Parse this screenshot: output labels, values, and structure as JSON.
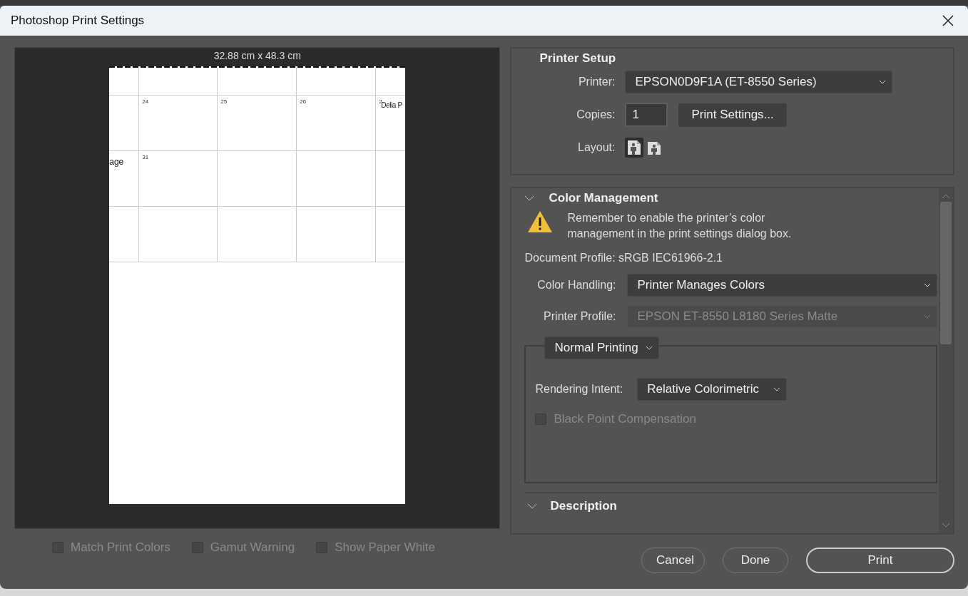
{
  "window": {
    "title": "Photoshop Print Settings"
  },
  "preview": {
    "size_label": "32.88 cm x 48.3 cm",
    "calendar_rows": [
      [
        {},
        {},
        {},
        {},
        {}
      ],
      [
        {},
        {
          "date": "24"
        },
        {
          "date": "25"
        },
        {
          "date": "26"
        },
        {
          "date": "2",
          "event": "Delia P"
        }
      ],
      [
        {
          "event": "age"
        },
        {
          "date": "31"
        },
        {},
        {},
        {}
      ],
      [
        {},
        {},
        {},
        {},
        {}
      ]
    ],
    "options": [
      {
        "label": "Match Print Colors",
        "checked": false,
        "disabled": true
      },
      {
        "label": "Gamut Warning",
        "checked": false,
        "disabled": true
      },
      {
        "label": "Show Paper White",
        "checked": false,
        "disabled": true
      }
    ]
  },
  "printer_setup": {
    "title": "Printer Setup",
    "printer_label": "Printer:",
    "printer": "EPSON0D9F1A (ET-8550 Series)",
    "copies_label": "Copies:",
    "copies": "1",
    "print_settings_button": "Print Settings...",
    "layout_label": "Layout:",
    "layouts": [
      {
        "kind": "portrait",
        "selected": true
      },
      {
        "kind": "landscape",
        "selected": false
      }
    ]
  },
  "color_management": {
    "title": "Color Management",
    "warning": "Remember to enable the printer’s color\nmanagement in the print settings dialog box.",
    "document_profile": "Document Profile: sRGB IEC61966-2.1",
    "color_handling": {
      "label": "Color Handling:",
      "value": "Printer Manages Colors"
    },
    "printer_profile": {
      "label": "Printer Profile:",
      "value": "EPSON ET-8550 L8180 Series Matte",
      "disabled": true
    },
    "mode": "Normal Printing",
    "rendering_intent": {
      "label": "Rendering Intent:",
      "value": "Relative Colorimetric"
    },
    "black_point": {
      "label": "Black Point Compensation",
      "checked": false,
      "disabled": true
    }
  },
  "description": {
    "title": "Description"
  },
  "buttons": [
    {
      "label": "Cancel",
      "primary": false
    },
    {
      "label": "Done",
      "primary": false
    },
    {
      "label": "Print",
      "primary": true
    }
  ]
}
